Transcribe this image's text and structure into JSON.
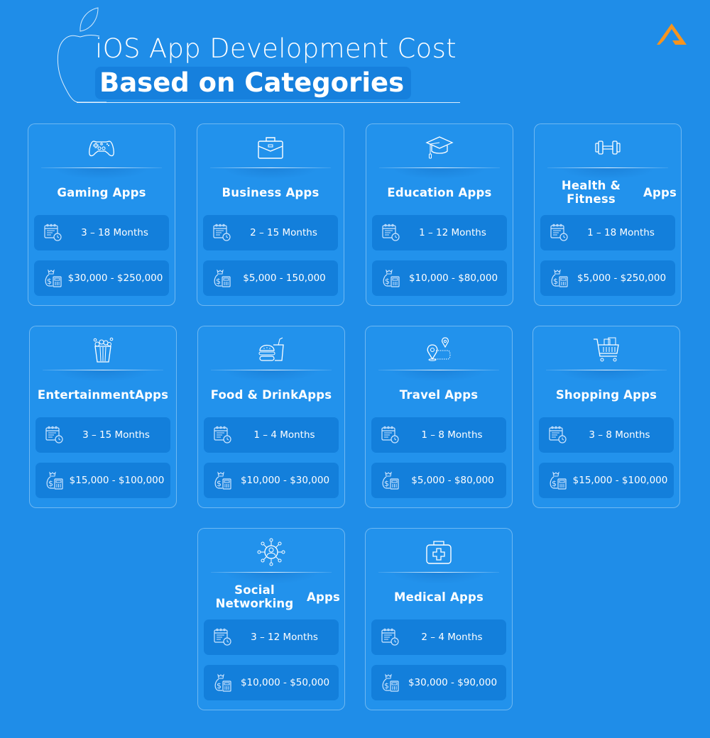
{
  "header": {
    "title_line1": "iOS App Development Cost",
    "title_line2": "Based on Categories",
    "decor_icon": "apple-logo-outline-icon",
    "brand_logo": "triangle-logo-icon",
    "brand_color": "#f7941d"
  },
  "colors": {
    "background": "#1f8de8",
    "card": "#2292ec",
    "pill": "#137fdb",
    "text": "#ffffff"
  },
  "cards": [
    {
      "name": "Gaming Apps",
      "icon": "game-controller-icon",
      "duration": "3 – 18 Months",
      "cost": "$30,000 - $250,000"
    },
    {
      "name": "Business Apps",
      "icon": "briefcase-icon",
      "duration": "2 – 15 Months",
      "cost": "$5,000 - 150,000"
    },
    {
      "name": "Education Apps",
      "icon": "graduation-cap-icon",
      "duration": "1 – 12 Months",
      "cost": "$10,000 - $80,000"
    },
    {
      "name": "Health & Fitness Apps",
      "icon": "dumbbell-icon",
      "duration": "1 – 18 Months",
      "cost": "$5,000 - $250,000"
    },
    {
      "name": "Entertainment Apps",
      "icon": "popcorn-icon",
      "duration": "3 – 15 Months",
      "cost": "$15,000 - $100,000"
    },
    {
      "name": "Food & Drink Apps",
      "icon": "burger-drink-icon",
      "duration": "1 – 4 Months",
      "cost": "$10,000 - $30,000"
    },
    {
      "name": "Travel Apps",
      "icon": "map-route-icon",
      "duration": "1 – 8 Months",
      "cost": "$5,000 - $80,000"
    },
    {
      "name": "Shopping Apps",
      "icon": "shopping-cart-icon",
      "duration": "3 – 8 Months",
      "cost": "$15,000 - $100,000"
    },
    {
      "name": "Social Networking Apps",
      "icon": "social-network-icon",
      "duration": "3 – 12 Months",
      "cost": "$10,000 - $50,000"
    },
    {
      "name": "Medical Apps",
      "icon": "medical-kit-icon",
      "duration": "2 – 4 Months",
      "cost": "$30,000 - $90,000"
    }
  ],
  "pill_icons": {
    "duration": "calendar-clock-icon",
    "cost": "money-bag-calculator-icon"
  }
}
